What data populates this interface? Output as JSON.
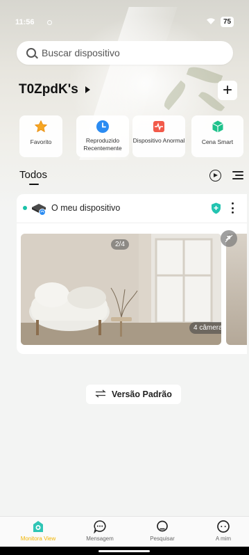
{
  "status_bar": {
    "time": "11:56",
    "battery": "75"
  },
  "search": {
    "placeholder": "Buscar dispositivo"
  },
  "home": {
    "title": "T0ZpdK's",
    "add_label": "+"
  },
  "quick_actions": [
    {
      "label": "Favorito",
      "icon": "star-icon",
      "color": "#f5a623"
    },
    {
      "label": "Reproduzido Recentemente",
      "icon": "clock-icon",
      "color": "#2b8cf2"
    },
    {
      "label": "Dispositivo Anormal",
      "icon": "alert-device-icon",
      "color": "#f25a4a"
    },
    {
      "label": "Cena Smart",
      "icon": "cube-icon",
      "color": "#1ec28b"
    }
  ],
  "tabs": {
    "active": "Todos"
  },
  "device": {
    "name": "O meu dispositivo",
    "status": "online",
    "status_color": "#19c2a8",
    "page_indicator": "2/4",
    "camera_count": "4 câmera(s)"
  },
  "view_switch": {
    "label": "Versão Padrão"
  },
  "bottom_nav": [
    {
      "label": "Monitora View",
      "icon": "home-camera-icon",
      "active": true
    },
    {
      "label": "Mensagem",
      "icon": "message-icon",
      "active": false
    },
    {
      "label": "Pesquisar",
      "icon": "search-icon",
      "active": false
    },
    {
      "label": "A mim",
      "icon": "profile-icon",
      "active": false
    }
  ],
  "colors": {
    "accent": "#f0b400",
    "online": "#19c2a8"
  }
}
